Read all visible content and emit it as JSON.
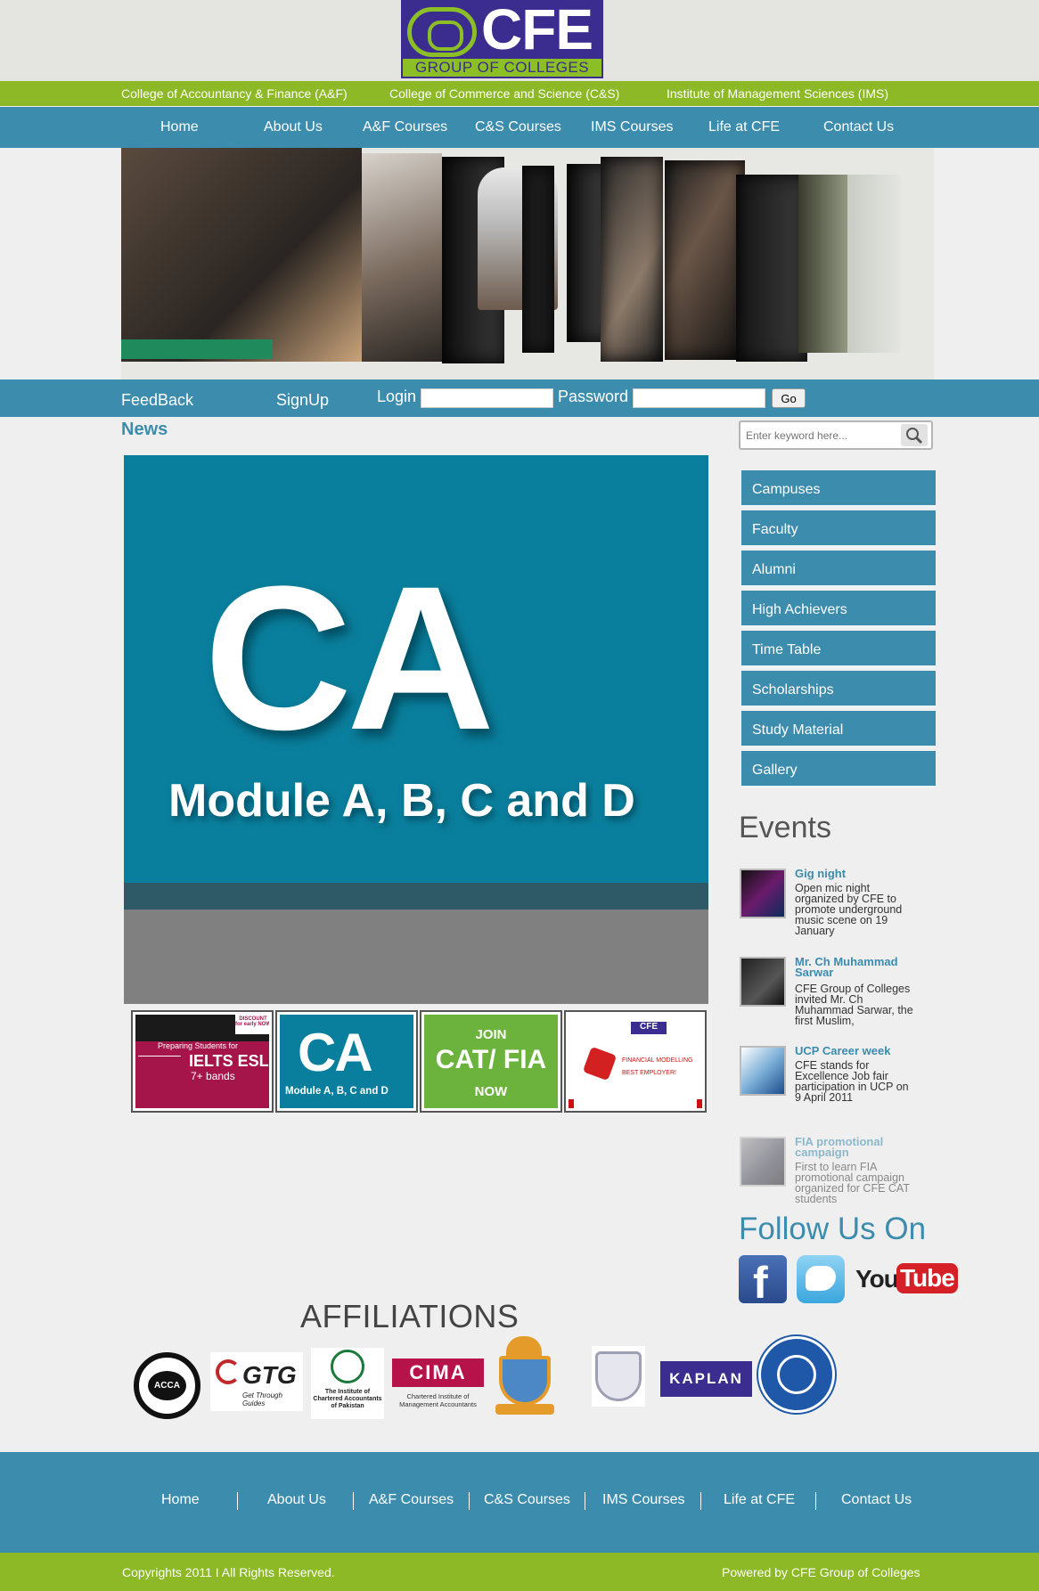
{
  "header": {
    "logo_text": "CFE",
    "logo_sub": "GROUP OF COLLEGES"
  },
  "colleges": [
    "College of Accountancy & Finance (A&F)",
    "College of Commerce and Science (C&S)",
    "Institute of Management Sciences (IMS)"
  ],
  "nav": [
    "Home",
    "About Us",
    "A&F Courses",
    "C&S Courses",
    "IMS Courses",
    "Life at CFE",
    "Contact Us"
  ],
  "loginbar": {
    "feedback": "FeedBack",
    "signup": "SignUp",
    "login_label": "Login",
    "password_label": "Password",
    "go": "Go"
  },
  "news": {
    "title": "News",
    "slide_big": "CA",
    "slide_sub": "Module A, B, C and D",
    "thumbs": [
      {
        "line1": "Preparing Students for",
        "line2": "IELTS ESL",
        "line3": "7+ bands",
        "badge": "DISCOUNT for early NOW"
      },
      {
        "line1": "CA",
        "line2": "Module A, B, C and D"
      },
      {
        "line1": "JOIN",
        "line2": "CAT/ FIA",
        "line3": "NOW"
      },
      {
        "line1": "CFE",
        "line2": "FINANCIAL MODELLING",
        "line3": "BEST EMPLOYER!"
      }
    ]
  },
  "search": {
    "placeholder": "Enter keyword here..."
  },
  "sidebar": [
    "Campuses",
    "Faculty",
    "Alumni",
    "High Achievers",
    "Time Table",
    "Scholarships",
    "Study Material",
    "Gallery"
  ],
  "events": {
    "title": "Events",
    "items": [
      {
        "title": "Gig night",
        "desc": "Open mic night organized by CFE to promote underground music scene on 19 January"
      },
      {
        "title": "Mr. Ch Muhammad Sarwar",
        "desc": "CFE Group of Colleges invited Mr. Ch Muhammad Sarwar, the first Muslim,"
      },
      {
        "title": "UCP Career week",
        "desc": "CFE stands for Excellence Job fair participation in UCP on 9 April 2011"
      },
      {
        "title": "FIA promotional campaign",
        "desc": "First to learn FIA promotional campaign organized for CFE CAT students"
      }
    ]
  },
  "follow": {
    "title": "Follow Us On",
    "facebook": "f",
    "youtube_a": "You",
    "youtube_b": "Tube"
  },
  "affiliations": {
    "title": "AFFILIATIONS",
    "acca": "ACCA",
    "gtg": "GTG",
    "gtg_sub": "Get Through Guides",
    "icap": "The Institute of Chartered Accountants of Pakistan",
    "cima": "CIMA",
    "cima_sub": "Chartered Institute of Management Accountants",
    "kaplan": "KAPLAN"
  },
  "footer": {
    "nav": [
      "Home",
      "About Us",
      "A&F Courses",
      "C&S Courses",
      "IMS Courses",
      "Life at CFE",
      "Contact Us"
    ],
    "copyright": "Copyrights 2011 I All Rights Reserved.",
    "powered": "Powered by CFE Group of Colleges"
  },
  "colors": {
    "teal": "#3b8cad",
    "green": "#8cb925",
    "purple": "#3b2d8f",
    "slide": "#0a7f9d"
  }
}
